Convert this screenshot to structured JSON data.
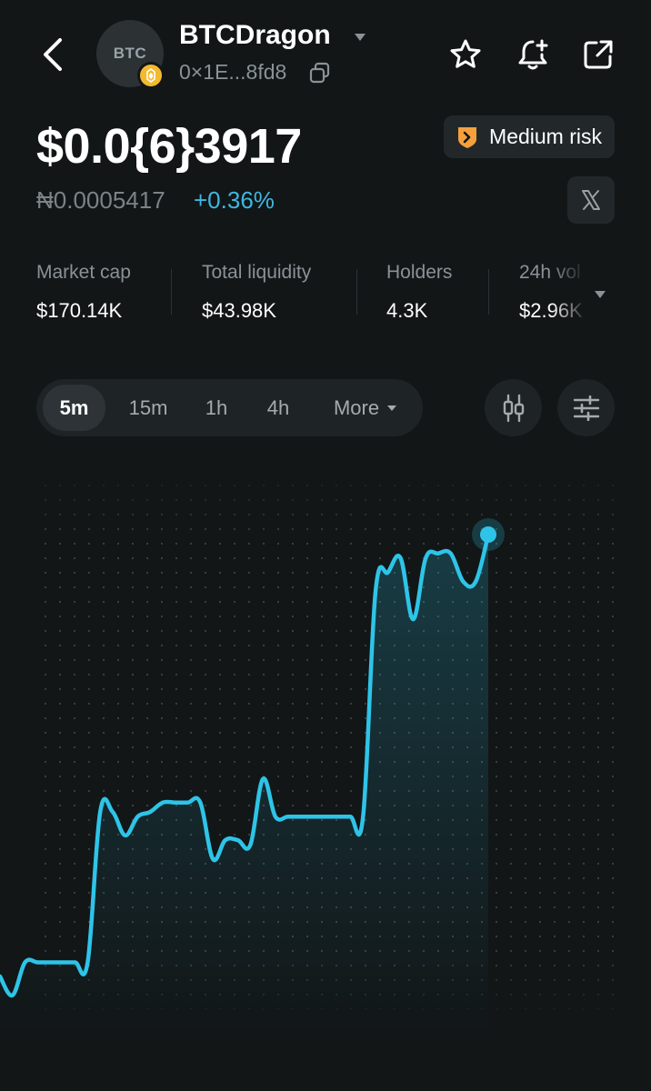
{
  "header": {
    "avatar_text": "BTC",
    "token_name": "BTCDragon",
    "token_address": "0×1E...8fd8"
  },
  "price": {
    "main": "$0.0{6}3917",
    "native": "₦0.0005417",
    "change": "+0.36%"
  },
  "risk": {
    "label": "Medium risk",
    "color": "#f5a03c"
  },
  "stats": [
    {
      "label": "Market cap",
      "value": "$170.14K"
    },
    {
      "label": "Total liquidity",
      "value": "$43.98K"
    },
    {
      "label": "Holders",
      "value": "4.3K"
    },
    {
      "label": "24h vol",
      "value": "$2.96K"
    }
  ],
  "intervals": [
    "5m",
    "15m",
    "1h",
    "4h",
    "More"
  ],
  "active_interval": "5m",
  "colors": {
    "accent": "#2ec4e8",
    "background": "#121617",
    "positive": "#3fb7e0"
  },
  "icons": [
    "back-arrow-icon",
    "chevron-down-icon",
    "copy-icon",
    "star-icon",
    "bell-plus-icon",
    "share-icon",
    "x-logo-icon",
    "candlestick-icon",
    "settings-sliders-icon",
    "bnb-chain-icon",
    "risk-shield-icon"
  ],
  "chart_data": {
    "type": "line",
    "title": "",
    "xlabel": "",
    "ylabel": "",
    "grid": "dotted",
    "series": [
      {
        "values": [
          0.06,
          0.02,
          0.09,
          0.09,
          0.09,
          0.09,
          0.09,
          0.09,
          0.41,
          0.41,
          0.36,
          0.4,
          0.41,
          0.43,
          0.43,
          0.43,
          0.43,
          0.31,
          0.35,
          0.35,
          0.34,
          0.48,
          0.4,
          0.4,
          0.4,
          0.4,
          0.4,
          0.4,
          0.4,
          0.4,
          0.88,
          0.92,
          0.95,
          0.82,
          0.95,
          0.96,
          0.96,
          0.9,
          0.9,
          1.0
        ]
      }
    ]
  }
}
